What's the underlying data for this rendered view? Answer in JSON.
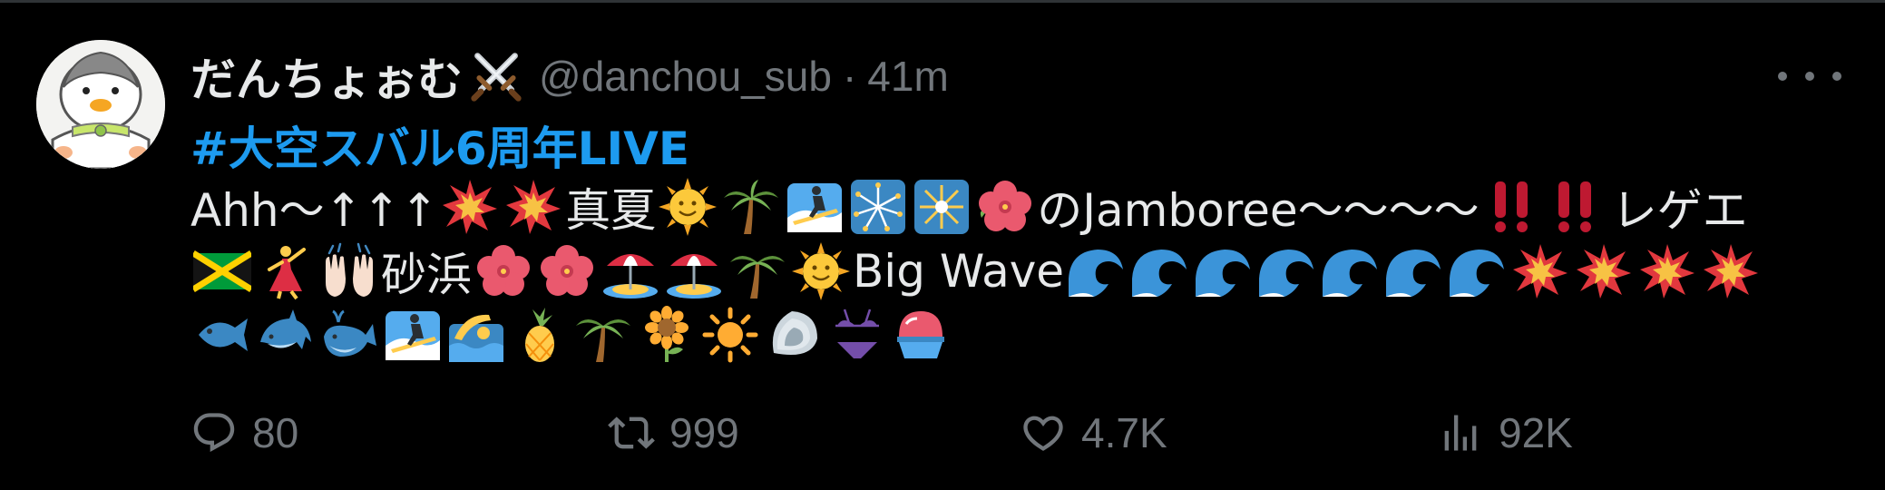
{
  "tweet": {
    "display_name": "だんちょぉむ",
    "name_emoji": "crossed-swords-icon",
    "handle": "@danchou_sub",
    "separator": "·",
    "time": "41m",
    "hashtag": "#大空スバル6周年LIVE",
    "body": {
      "line1": {
        "t1": "Ahh〜↑↑↑",
        "t2": "真夏",
        "t3": "のJamboree〜〜〜〜",
        "t4": "レゲエ"
      },
      "line2": {
        "t1": "砂浜",
        "t2": "Big Wave"
      }
    },
    "emojis": {
      "line1": [
        "collision",
        "collision",
        "sun-with-face",
        "palm-tree",
        "surfer",
        "sparkler",
        "fireworks",
        "hibiscus",
        "double-exclamation",
        "double-exclamation"
      ],
      "line2": [
        "jamaica-flag",
        "dancer",
        "raised-hands",
        "hibiscus",
        "hibiscus",
        "beach-umbrella",
        "beach-umbrella",
        "palm-tree",
        "sun-with-face",
        "wave",
        "wave",
        "wave",
        "wave",
        "wave",
        "wave",
        "wave",
        "collision",
        "collision",
        "collision",
        "collision"
      ],
      "line3": [
        "fish",
        "dolphin",
        "whale",
        "surfer",
        "swimmer",
        "pineapple",
        "palm-tree",
        "sunflower",
        "sun",
        "shell",
        "bikini",
        "shaved-ice"
      ]
    },
    "actions": {
      "replies": "80",
      "retweets": "999",
      "likes": "4.7K",
      "views": "92K"
    }
  },
  "colors": {
    "background": "#000000",
    "text": "#e7e9ea",
    "muted": "#71767b",
    "link": "#1d9bf0"
  }
}
